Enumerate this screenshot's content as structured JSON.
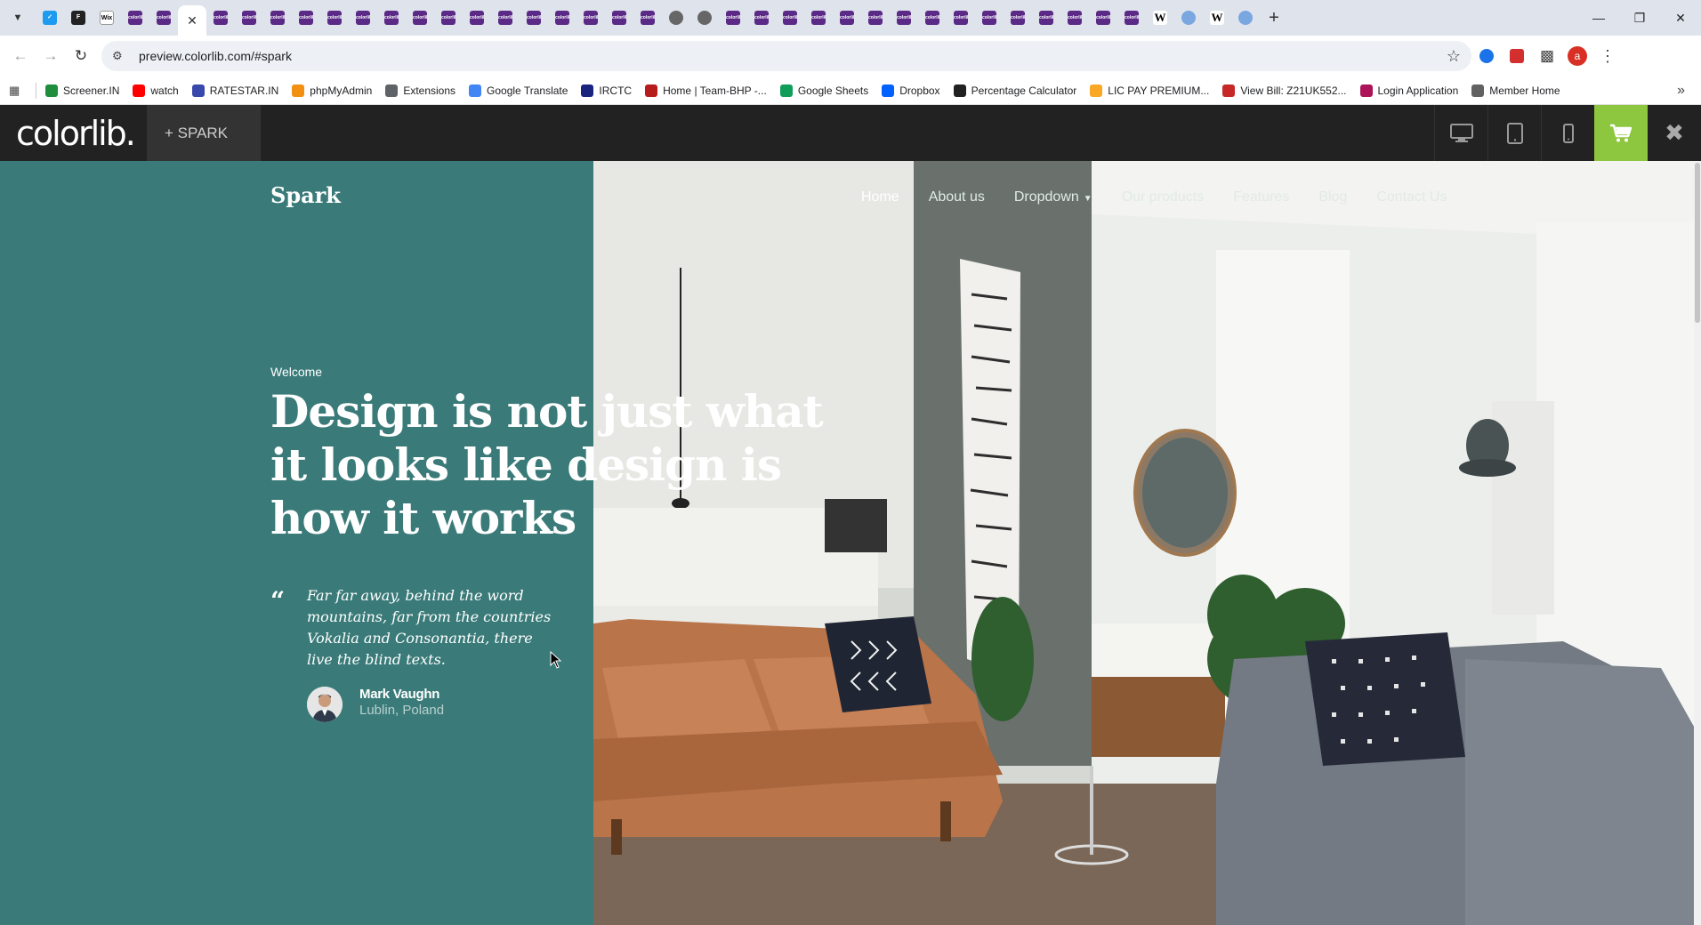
{
  "browser": {
    "tab_favicons": [
      "twitter",
      "bold",
      "wix",
      "colorlib",
      "colorlib",
      "active-colorlib",
      "colorlib",
      "colorlib",
      "colorlib",
      "colorlib",
      "colorlib",
      "colorlib",
      "colorlib",
      "colorlib",
      "colorlib",
      "colorlib",
      "colorlib",
      "colorlib",
      "colorlib",
      "colorlib",
      "colorlib",
      "colorlib",
      "globe",
      "globe",
      "colorlib",
      "colorlib",
      "colorlib",
      "colorlib",
      "colorlib",
      "colorlib",
      "colorlib",
      "colorlib",
      "colorlib",
      "colorlib",
      "colorlib",
      "colorlib",
      "colorlib",
      "colorlib",
      "colorlib",
      "wiki",
      "world",
      "wiki",
      "world"
    ],
    "url": "preview.colorlib.com/#spark",
    "profile_initial": "a"
  },
  "bookmarks": [
    {
      "label": "Screener.IN",
      "color": "#1e8e3e"
    },
    {
      "label": "watch",
      "color": "#ff0000"
    },
    {
      "label": "RATESTAR.IN",
      "color": "#3949ab"
    },
    {
      "label": "phpMyAdmin",
      "color": "#f29111"
    },
    {
      "label": "Extensions",
      "color": "#5f6368"
    },
    {
      "label": "Google Translate",
      "color": "#4285f4"
    },
    {
      "label": "IRCTC",
      "color": "#1a237e"
    },
    {
      "label": "Home | Team-BHP -...",
      "color": "#b71c1c"
    },
    {
      "label": "Google Sheets",
      "color": "#0f9d58"
    },
    {
      "label": "Dropbox",
      "color": "#0061ff"
    },
    {
      "label": "Percentage Calculator",
      "color": "#212121"
    },
    {
      "label": "LIC PAY PREMIUM...",
      "color": "#f9a825"
    },
    {
      "label": "View Bill: Z21UK552...",
      "color": "#c62828"
    },
    {
      "label": "Login Application",
      "color": "#ad1457"
    },
    {
      "label": "Member Home",
      "color": "#616161"
    }
  ],
  "colorlib_bar": {
    "logo": "colorlib.",
    "theme_label": "+  SPARK",
    "accent": "#8dc63f"
  },
  "site": {
    "brand": "Spark",
    "menu": [
      "Home",
      "About us",
      "Dropdown",
      "Our products",
      "Features",
      "Blog",
      "Contact Us"
    ],
    "welcome": "Welcome",
    "headline": "Design is not just what it looks like design is how it works",
    "quote_mark": "“",
    "quote": "Far far away, behind the word mountains, far from the countries Vokalia and Consonantia, there live the blind texts.",
    "author": "Mark Vaughn",
    "location": "Lublin, Poland",
    "teal_color": "#3a7b79"
  }
}
